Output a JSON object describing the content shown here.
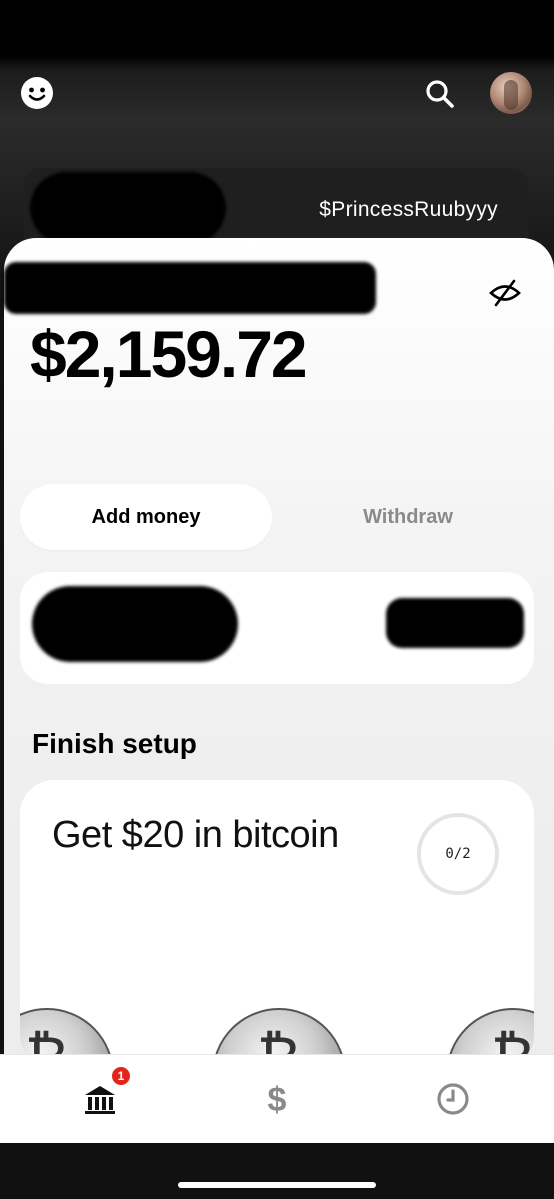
{
  "header": {
    "profile_icon": "smiley-icon",
    "search_icon": "search-icon",
    "avatar_icon": "avatar"
  },
  "account": {
    "cashtag": "$PrincessRuubyyy"
  },
  "balance": {
    "amount": "$2,159.72",
    "privacy_icon": "eye-slash-icon"
  },
  "actions": {
    "add_money": "Add money",
    "withdraw": "Withdraw"
  },
  "setup": {
    "section_title": "Finish setup",
    "card_title": "Get $20 in bitcoin",
    "progress_label": "0/2",
    "progress_completed": 0,
    "progress_total": 2
  },
  "tabbar": {
    "items": [
      {
        "icon": "bank-icon",
        "badge": "1"
      },
      {
        "icon": "dollar-icon"
      },
      {
        "icon": "clock-icon"
      }
    ]
  },
  "colors": {
    "badge": "#e1251b",
    "background_dark": "#000000"
  }
}
